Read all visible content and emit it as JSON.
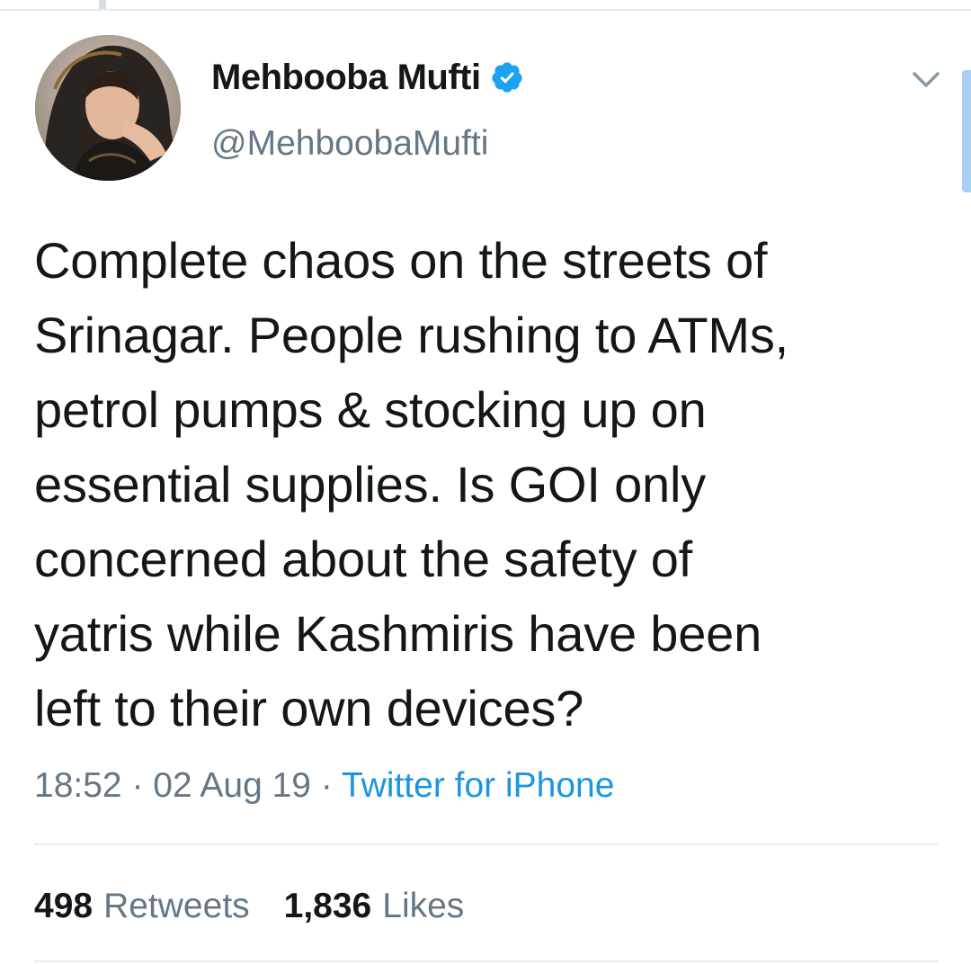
{
  "author": {
    "display_name": "Mehbooba Mufti",
    "username": "@MehboobaMufti",
    "verified": true,
    "avatar_icon": "profile-photo"
  },
  "tweet": {
    "text": "Complete chaos on the streets of\nSrinagar. People rushing to ATMs,\npetrol pumps & stocking up on\nessential supplies. Is GOI only\nconcerned about the safety of\nyatris while Kashmiris have been\nleft to their own devices?",
    "time": "18:52",
    "date": "02 Aug 19",
    "separator": "·",
    "source": "Twitter for iPhone"
  },
  "stats": {
    "retweets_count": "498",
    "retweets_label": "Retweets",
    "likes_count": "1,836",
    "likes_label": "Likes"
  },
  "icons": {
    "verified": "verified-badge-icon",
    "menu": "chevron-down-icon"
  },
  "colors": {
    "link": "#1b95e0",
    "verified": "#1da1f2",
    "secondary_text": "#657786",
    "primary_text": "#14171a",
    "divider": "#e6ecf0"
  }
}
